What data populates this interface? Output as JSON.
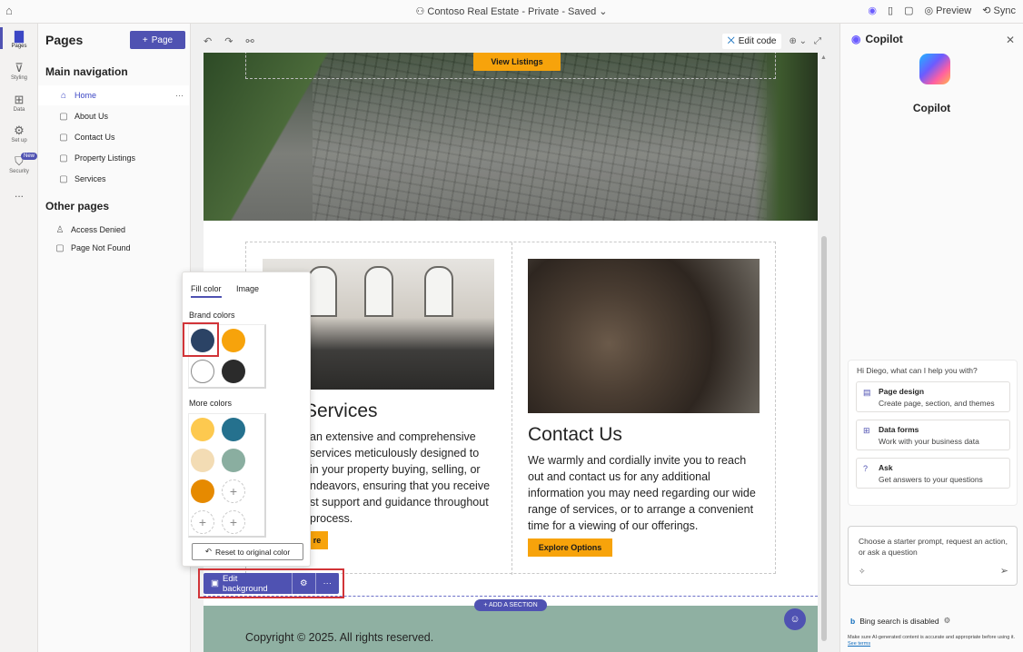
{
  "topbar": {
    "title": "Contoso Real Estate - Private - Saved",
    "preview_label": "Preview",
    "sync_label": "Sync"
  },
  "rail": {
    "items": [
      {
        "label": "Pages",
        "icon": "page-icon"
      },
      {
        "label": "Styling",
        "icon": "brush-icon"
      },
      {
        "label": "Data",
        "icon": "table-icon"
      },
      {
        "label": "Set up",
        "icon": "settings-doc-icon"
      },
      {
        "label": "Security",
        "icon": "shield-icon"
      }
    ],
    "new_badge": "New",
    "more": "..."
  },
  "pages_panel": {
    "title": "Pages",
    "add_button": "Page",
    "main_nav_title": "Main navigation",
    "main_nav": [
      {
        "label": "Home",
        "icon": "home-icon",
        "selected": true
      },
      {
        "label": "About Us",
        "icon": "page-icon"
      },
      {
        "label": "Contact Us",
        "icon": "page-icon"
      },
      {
        "label": "Property Listings",
        "icon": "page-icon"
      },
      {
        "label": "Services",
        "icon": "page-icon"
      }
    ],
    "other_title": "Other pages",
    "other_pages": [
      {
        "label": "Access Denied",
        "icon": "person-lock-icon"
      },
      {
        "label": "Page Not Found",
        "icon": "page-error-icon"
      }
    ]
  },
  "canvas": {
    "edit_code": "Edit code",
    "hero_button": "View Listings",
    "services": {
      "title": "Services",
      "text_lines": [
        "an extensive and comprehensive",
        "services meticulously designed to",
        "in your property buying, selling, or",
        "ndeavors, ensuring that you receive",
        "st support and guidance throughout",
        "process."
      ],
      "button": "re"
    },
    "contact": {
      "title": "Contact Us",
      "text_lines": [
        "We warmly and cordially invite you to reach",
        "out and contact us for any additional",
        "information you may need regarding our wide",
        "range of services, or to arrange a convenient",
        "time for a viewing of our offerings."
      ],
      "button": "Explore Options"
    },
    "add_section": "ADD A SECTION",
    "footer_text": "Copyright © 2025. All rights reserved."
  },
  "color_popover": {
    "tabs": [
      "Fill color",
      "Image"
    ],
    "active_tab": "Fill color",
    "brand_label": "Brand colors",
    "brand_colors": [
      "#2b4365",
      "#f7a30b",
      "#ffffff",
      "#2b2b2b"
    ],
    "more_label": "More colors",
    "more_colors": [
      "#fdc94f",
      "#25718e",
      "#f3dcb4",
      "#8aaea0",
      "#e68a00"
    ],
    "reset_label": "Reset to original color"
  },
  "edit_toolbar": {
    "edit_background": "Edit background"
  },
  "copilot": {
    "title": "Copilot",
    "name": "Copilot",
    "greeting": "Hi Diego, what can I help you with?",
    "prompts": [
      {
        "title": "Page design",
        "subtitle": "Create page, section, and themes",
        "icon": "page-design-icon"
      },
      {
        "title": "Data forms",
        "subtitle": "Work with your business data",
        "icon": "table-icon"
      },
      {
        "title": "Ask",
        "subtitle": "Get answers to your questions",
        "icon": "chat-question-icon"
      }
    ],
    "input_placeholder": "Choose a starter prompt, request an action, or ask a question",
    "bing_status": "Bing search is disabled",
    "disclaimer": "Make sure AI-generated content is accurate and appropriate before using it.",
    "see_terms": "See terms"
  },
  "colors": {
    "accent": "#4f52b2",
    "highlight": "#d13438",
    "cta": "#f7a30b"
  }
}
